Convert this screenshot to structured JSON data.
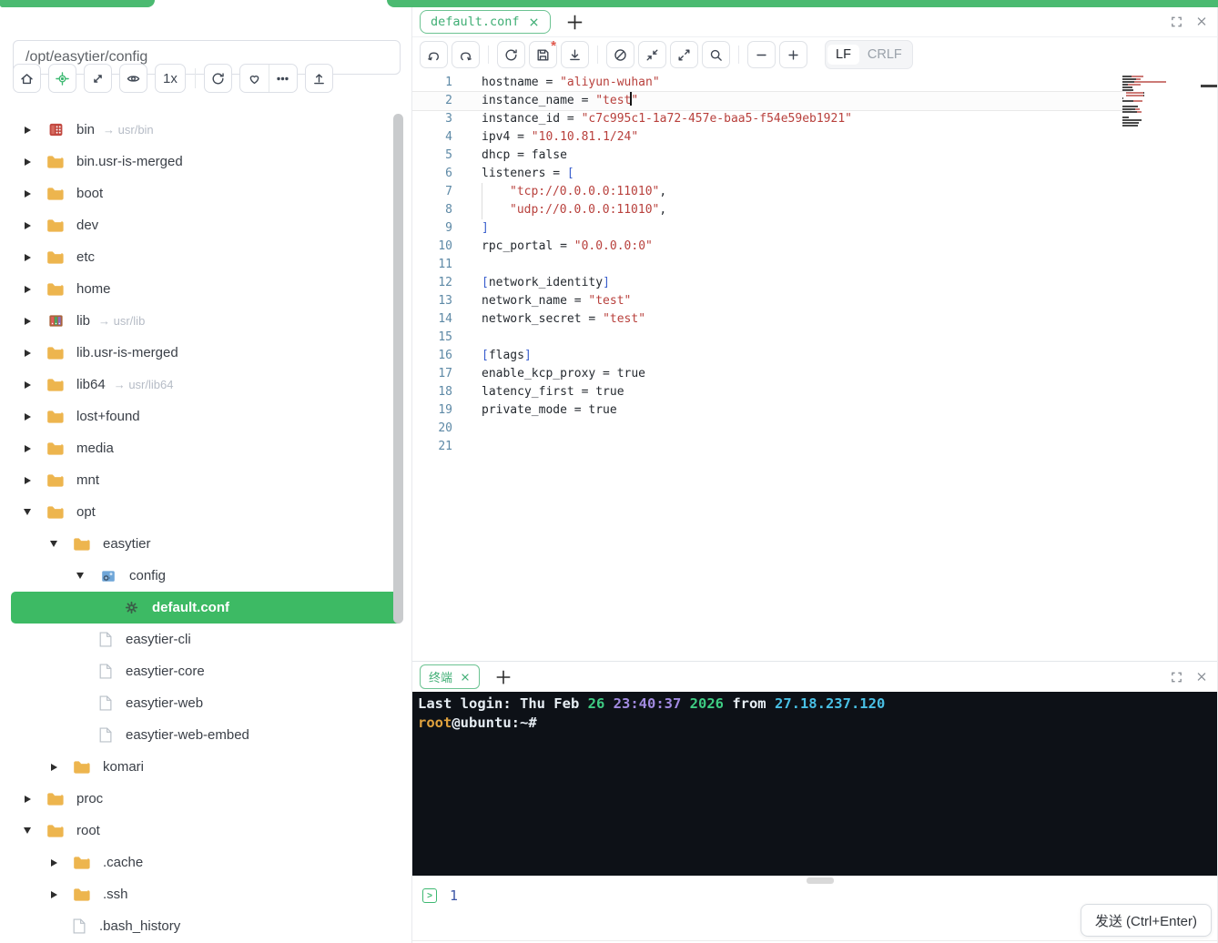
{
  "colors": {
    "accent_green": "#3eb972",
    "selected_row_green": "#3dba64",
    "terminal_bg": "#0d1117",
    "code_string": "#b8403c",
    "code_bracket": "#3a5fcd",
    "line_number_blue": "#5d89a6"
  },
  "sidebar": {
    "path": "/opt/easytier/config",
    "toolbar": [
      {
        "name": "home"
      },
      {
        "name": "locate"
      },
      {
        "name": "fit"
      },
      {
        "name": "eye"
      },
      {
        "name": "zoom-level",
        "label": "1x"
      },
      {
        "name": "refresh"
      },
      {
        "name": "favorite",
        "group": "a"
      },
      {
        "name": "more",
        "group": "a"
      },
      {
        "name": "upload"
      }
    ],
    "tree": [
      {
        "name": "bin",
        "type": "bin",
        "level": 0,
        "arrow": "right",
        "link": "→ usr/bin"
      },
      {
        "name": "bin.usr-is-merged",
        "type": "folder",
        "level": 0,
        "arrow": "right"
      },
      {
        "name": "boot",
        "type": "folder",
        "level": 0,
        "arrow": "right"
      },
      {
        "name": "dev",
        "type": "folder",
        "level": 0,
        "arrow": "right"
      },
      {
        "name": "etc",
        "type": "folder",
        "level": 0,
        "arrow": "right"
      },
      {
        "name": "home",
        "type": "folder",
        "level": 0,
        "arrow": "right"
      },
      {
        "name": "lib",
        "type": "lib",
        "level": 0,
        "arrow": "right",
        "link": "→ usr/lib"
      },
      {
        "name": "lib.usr-is-merged",
        "type": "folder",
        "level": 0,
        "arrow": "right"
      },
      {
        "name": "lib64",
        "type": "folder",
        "level": 0,
        "arrow": "right",
        "link": "→ usr/lib64"
      },
      {
        "name": "lost+found",
        "type": "folder",
        "level": 0,
        "arrow": "right"
      },
      {
        "name": "media",
        "type": "folder",
        "level": 0,
        "arrow": "right"
      },
      {
        "name": "mnt",
        "type": "folder",
        "level": 0,
        "arrow": "right"
      },
      {
        "name": "opt",
        "type": "folder",
        "level": 0,
        "arrow": "down"
      },
      {
        "name": "easytier",
        "type": "folder",
        "level": 1,
        "arrow": "down"
      },
      {
        "name": "config",
        "type": "config",
        "level": 2,
        "arrow": "down"
      },
      {
        "name": "default.conf",
        "type": "conf",
        "level": 3,
        "selected": true
      },
      {
        "name": "easytier-cli",
        "type": "file",
        "level": 2
      },
      {
        "name": "easytier-core",
        "type": "file",
        "level": 2
      },
      {
        "name": "easytier-web",
        "type": "file",
        "level": 2
      },
      {
        "name": "easytier-web-embed",
        "type": "file",
        "level": 2
      },
      {
        "name": "komari",
        "type": "folder",
        "level": 1,
        "arrow": "right"
      },
      {
        "name": "proc",
        "type": "folder",
        "level": 0,
        "arrow": "right"
      },
      {
        "name": "root",
        "type": "folder",
        "level": 0,
        "arrow": "down"
      },
      {
        "name": ".cache",
        "type": "folder",
        "level": 1,
        "arrow": "right"
      },
      {
        "name": ".ssh",
        "type": "folder",
        "level": 1,
        "arrow": "right"
      },
      {
        "name": ".bash_history",
        "type": "file",
        "level": 1
      }
    ]
  },
  "editor": {
    "tab_label": "default.conf",
    "toolbar": [
      {
        "name": "undo"
      },
      {
        "name": "redo"
      },
      {
        "name": "divider"
      },
      {
        "name": "reload"
      },
      {
        "name": "save",
        "modified": true
      },
      {
        "name": "download"
      },
      {
        "name": "divider"
      },
      {
        "name": "compass"
      },
      {
        "name": "collapse"
      },
      {
        "name": "expand"
      },
      {
        "name": "search"
      },
      {
        "name": "divider"
      },
      {
        "name": "zoom-out"
      },
      {
        "name": "zoom-in"
      }
    ],
    "eol": {
      "options": [
        "LF",
        "CRLF"
      ],
      "selected": "LF"
    },
    "lines": [
      {
        "n": "1",
        "t": [
          {
            "c": "d",
            "v": "hostname = "
          },
          {
            "c": "s",
            "v": "\"aliyun-wuhan\""
          }
        ]
      },
      {
        "n": "2",
        "active": true,
        "t": [
          {
            "c": "d",
            "v": "instance_name = "
          },
          {
            "c": "s",
            "v": "\"test"
          },
          {
            "c": "cur"
          },
          {
            "c": "s",
            "v": "\""
          }
        ]
      },
      {
        "n": "3",
        "t": [
          {
            "c": "d",
            "v": "instance_id = "
          },
          {
            "c": "s",
            "v": "\"c7c995c1-1a72-457e-baa5-f54e59eb1921\""
          }
        ]
      },
      {
        "n": "4",
        "t": [
          {
            "c": "d",
            "v": "ipv4 = "
          },
          {
            "c": "s",
            "v": "\"10.10.81.1/24\""
          }
        ]
      },
      {
        "n": "5",
        "t": [
          {
            "c": "d",
            "v": "dhcp = false"
          }
        ]
      },
      {
        "n": "6",
        "t": [
          {
            "c": "d",
            "v": "listeners = "
          },
          {
            "c": "b",
            "v": "["
          }
        ]
      },
      {
        "n": "7",
        "t": [
          {
            "c": "g"
          },
          {
            "c": "s",
            "v": "\"tcp://0.0.0.0:11010\""
          },
          {
            "c": "d",
            "v": ","
          }
        ]
      },
      {
        "n": "8",
        "t": [
          {
            "c": "g"
          },
          {
            "c": "s",
            "v": "\"udp://0.0.0.0:11010\""
          },
          {
            "c": "d",
            "v": ","
          }
        ]
      },
      {
        "n": "9",
        "t": [
          {
            "c": "b",
            "v": "]"
          }
        ]
      },
      {
        "n": "10",
        "t": [
          {
            "c": "d",
            "v": "rpc_portal = "
          },
          {
            "c": "s",
            "v": "\"0.0.0.0:0\""
          }
        ]
      },
      {
        "n": "11",
        "t": []
      },
      {
        "n": "12",
        "t": [
          {
            "c": "b",
            "v": "["
          },
          {
            "c": "d",
            "v": "network_identity"
          },
          {
            "c": "b",
            "v": "]"
          }
        ]
      },
      {
        "n": "13",
        "t": [
          {
            "c": "d",
            "v": "network_name = "
          },
          {
            "c": "s",
            "v": "\"test\""
          }
        ]
      },
      {
        "n": "14",
        "t": [
          {
            "c": "d",
            "v": "network_secret = "
          },
          {
            "c": "s",
            "v": "\"test\""
          }
        ]
      },
      {
        "n": "15",
        "t": []
      },
      {
        "n": "16",
        "t": [
          {
            "c": "b",
            "v": "["
          },
          {
            "c": "d",
            "v": "flags"
          },
          {
            "c": "b",
            "v": "]"
          }
        ]
      },
      {
        "n": "17",
        "t": [
          {
            "c": "d",
            "v": "enable_kcp_proxy = true"
          }
        ]
      },
      {
        "n": "18",
        "t": [
          {
            "c": "d",
            "v": "latency_first = true"
          }
        ]
      },
      {
        "n": "19",
        "t": [
          {
            "c": "d",
            "v": "private_mode = true"
          }
        ]
      },
      {
        "n": "20",
        "t": []
      },
      {
        "n": "21",
        "t": []
      }
    ]
  },
  "terminal": {
    "tab_label": "终端",
    "lines": [
      [
        {
          "c": "w",
          "v": "Last login: Thu Feb "
        },
        {
          "c": "g",
          "v": "26"
        },
        {
          "c": "w",
          "v": " "
        },
        {
          "c": "p",
          "v": "23:40:37"
        },
        {
          "c": "w",
          "v": " "
        },
        {
          "c": "g",
          "v": "2026"
        },
        {
          "c": "w",
          "v": " from "
        },
        {
          "c": "c",
          "v": "27.18.237.120"
        }
      ],
      [
        {
          "c": "o",
          "v": "root"
        },
        {
          "c": "w",
          "v": "@ubuntu:~#"
        }
      ]
    ]
  },
  "command": {
    "line_number": "1",
    "send_label": "发送 (Ctrl+Enter)"
  }
}
